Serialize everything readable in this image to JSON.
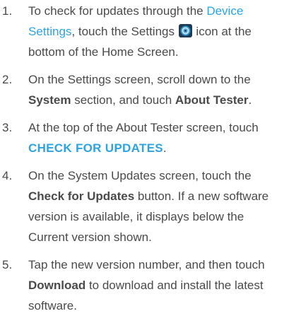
{
  "steps": [
    {
      "num": "1.",
      "p1": "To check for updates through the ",
      "link": "Device Settings",
      "p2": ", touch the Settings ",
      "icon": "settings-gear-icon",
      "p3": " icon at the bottom of the Home Screen."
    },
    {
      "num": "2.",
      "p1": "On the Settings screen, scroll down to the ",
      "b1": "System",
      "p2": " section, and touch ",
      "b2": "About Tester",
      "p3": "."
    },
    {
      "num": "3.",
      "p1": "At the top of the About Tester screen, touch ",
      "cta": "CHECK FOR UPDATES",
      "p2": "."
    },
    {
      "num": "4.",
      "p1": "On the System Updates screen, touch the ",
      "b1": "Check for Updates",
      "p2": " button. If a new software version is available, it displays below the Current version shown."
    },
    {
      "num": "5.",
      "p1": "Tap the new version number, and then touch ",
      "b1": "Download",
      "p2": " to download and install the latest software."
    }
  ],
  "colors": {
    "text": "#4a4a4a",
    "link": "#2ea3dd",
    "icon_bg": "#1e3b55"
  }
}
